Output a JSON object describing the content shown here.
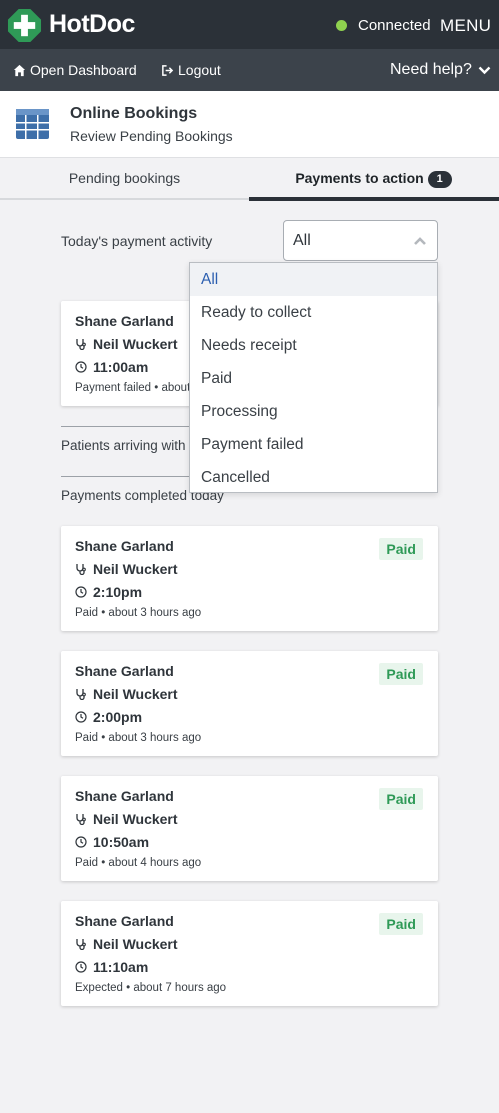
{
  "topbar": {
    "brand": "HotDoc",
    "status": "Connected",
    "menu": "MENU",
    "status_color": "#8fd14f",
    "brand_color": "#2f9a57"
  },
  "subnav": {
    "open_dashboard": "Open Dashboard",
    "logout": "Logout",
    "help": "Need help?"
  },
  "header": {
    "title": "Online Bookings",
    "subtitle": "Review Pending Bookings"
  },
  "tabs": [
    {
      "label": "Pending bookings"
    },
    {
      "label": "Payments to action",
      "badge": "1"
    }
  ],
  "filter": {
    "label": "Today's payment activity",
    "value": "All",
    "options": [
      "All",
      "Ready to collect",
      "Needs receipt",
      "Paid",
      "Processing",
      "Payment failed",
      "Cancelled"
    ]
  },
  "failed_card": {
    "patient": "Shane Garland",
    "doctor": "Neil Wuckert",
    "time": "11:00am",
    "footer": "Payment failed • about"
  },
  "sections": {
    "arriving": "Patients arriving with",
    "completed": "Payments completed today"
  },
  "completed_cards": [
    {
      "patient": "Shane Garland",
      "doctor": "Neil Wuckert",
      "time": "2:10pm",
      "footer": "Paid • about 3 hours ago",
      "badge": "Paid"
    },
    {
      "patient": "Shane Garland",
      "doctor": "Neil Wuckert",
      "time": "2:00pm",
      "footer": "Paid • about 3 hours ago",
      "badge": "Paid"
    },
    {
      "patient": "Shane Garland",
      "doctor": "Neil Wuckert",
      "time": "10:50am",
      "footer": "Paid • about 4 hours ago",
      "badge": "Paid"
    },
    {
      "patient": "Shane Garland",
      "doctor": "Neil Wuckert",
      "time": "11:10am",
      "footer": "Expected • about 7 hours ago",
      "badge": "Paid"
    }
  ]
}
